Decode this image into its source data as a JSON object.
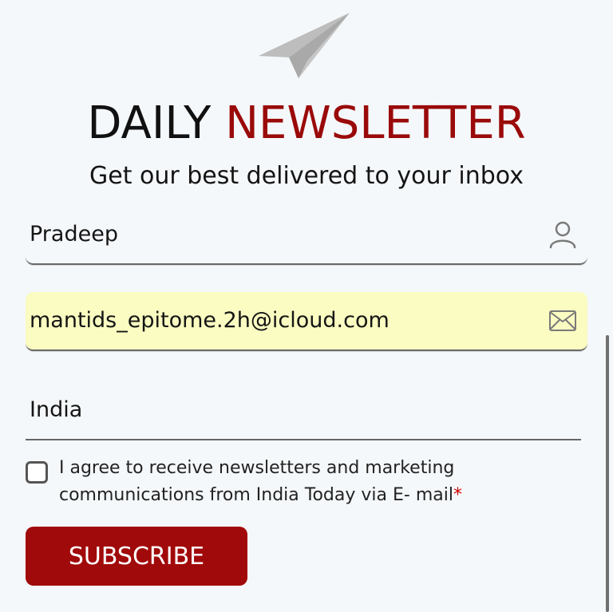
{
  "header": {
    "logo_icon": "paper-plane-icon",
    "title_part1": "DAILY",
    "title_part2": "NEWSLETTER",
    "subtitle": "Get our best delivered to your inbox"
  },
  "form": {
    "name": {
      "value": "Pradeep",
      "icon": "user-icon"
    },
    "email": {
      "value": "mantids_epitome.2h@icloud.com",
      "icon": "envelope-icon"
    },
    "country": {
      "value": "India"
    },
    "consent": {
      "checked": false,
      "text": "I agree to receive newsletters and marketing communications from India Today via E- mail",
      "required_mark": "*"
    },
    "subscribe_label": "SUBSCRIBE"
  },
  "colors": {
    "accent": "#a10a0a",
    "background": "#f5f8fa",
    "email_autofill_bg": "#fafcc1",
    "required": "#cc0000"
  }
}
